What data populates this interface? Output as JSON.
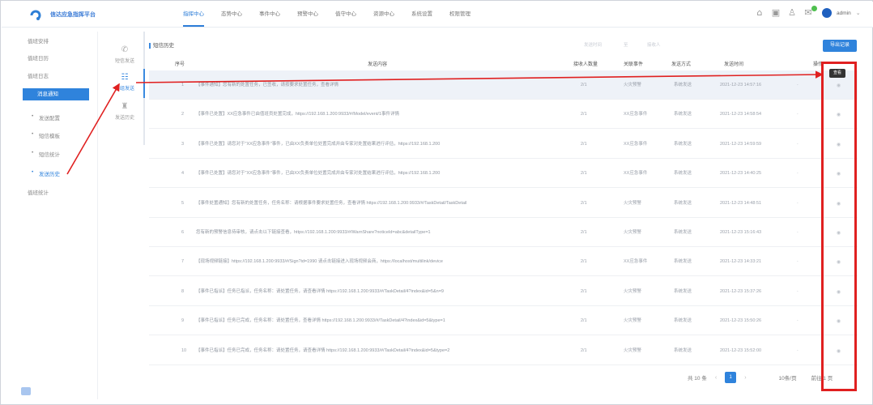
{
  "header": {
    "app_title": "信达应急指挥平台",
    "nav": [
      "指挥中心",
      "态势中心",
      "事件中心",
      "预警中心",
      "值守中心",
      "资源中心",
      "系统设置",
      "权限管理"
    ],
    "user": "admin",
    "icons": [
      "home-icon",
      "screen-icon",
      "user-icon",
      "message-icon"
    ]
  },
  "sidebar": {
    "items": [
      "值班安排",
      "值班日历",
      "值班日志",
      "消息通知",
      "值班统计"
    ],
    "sub": [
      "发送配置",
      "短信模板",
      "短信统计",
      "发送历史"
    ]
  },
  "subtabs": [
    {
      "label": "短信发送",
      "icon": "phone-icon"
    },
    {
      "label": "群组发送",
      "icon": "group-icon"
    },
    {
      "label": "发送历史",
      "icon": "history-icon"
    }
  ],
  "main": {
    "breadcrumb": "短信历史",
    "filters": [
      "发送时间",
      "至",
      "接收人"
    ],
    "export_label": "导出记录",
    "columns": [
      "序号",
      "发送内容",
      "接收人数量",
      "关联事件",
      "发送方式",
      "发送时间",
      "操作"
    ],
    "tooltip": "查看"
  },
  "rows": [
    {
      "n": "1",
      "content": "【事件通知】您有新的处置任务，已签收，请按要求处置任务，查看详情",
      "count": "2/1",
      "event": "火灾预警",
      "way": "系统发送",
      "time": "2021-12-23 14:57:16"
    },
    {
      "n": "2",
      "content": "【事件已处置】XX应急事件已由值班员处置完成，https://192.168.1.200:9933/#/Model/event/1事件详情",
      "count": "2/1",
      "event": "XX应急事件",
      "way": "系统发送",
      "time": "2021-12-23 14:58:54"
    },
    {
      "n": "3",
      "content": "【事件已处置】请您对于\"XX应急事件\"事件，已由XX负责单位处置完成并由专家对处置结果进行评估，https://192.168.1.200",
      "count": "2/1",
      "event": "XX应急事件",
      "way": "系统发送",
      "time": "2021-12-23 14:59:59"
    },
    {
      "n": "4",
      "content": "【事件已处置】请您对于\"XX应急事件\"事件，已由XX负责单位处置完成并由专家对处置结果进行评估，https://192.168.1.200",
      "count": "2/1",
      "event": "XX应急事件",
      "way": "系统发送",
      "time": "2021-12-23 14:40:25"
    },
    {
      "n": "5",
      "content": "【事件处置通知】您有新的处置任务，任务名称：请根据事件要求处置任务，查看详情 https://192.168.1.200:9933/#/TaskDetail/TaskDetail",
      "count": "2/1",
      "event": "火灾预警",
      "way": "系统发送",
      "time": "2021-12-23 14:48:51"
    },
    {
      "n": "6",
      "content": "您有新的预警信息待审核，请点击以下链接查看，https://192.168.1.200:9933/#/WarnShare?noticeId=abc&detailType=1",
      "count": "2/1",
      "event": "火灾预警",
      "way": "系统发送",
      "time": "2021-12-23 15:16:43"
    },
    {
      "n": "7",
      "content": "【现场视频链接】https://192.168.1.200:9933/#/Sign?id=1990 请点击链接进入现场视频会商，https://localhost/multilink/device",
      "count": "2/1",
      "event": "XX应急事件",
      "way": "系统发送",
      "time": "2021-12-23 14:33:21"
    },
    {
      "n": "8",
      "content": "【事件已指派】任务已指派，任务名称：请处置任务，请查看详情 https://192.168.1.200:9933/#/TaskDetail/4?index&id=5&n=9",
      "count": "2/1",
      "event": "火灾预警",
      "way": "系统发送",
      "time": "2021-12-23 15:37:26"
    },
    {
      "n": "9",
      "content": "【事件已指派】任务已完成，任务名称：请处置任务，查看详情 https://192.168.1.200:9933/#/TaskDetail/4?index&id=5&type=1",
      "count": "2/1",
      "event": "火灾预警",
      "way": "系统发送",
      "time": "2021-12-23 15:50:26"
    },
    {
      "n": "10",
      "content": "【事件已指派】任务已完成，任务名称：请处置任务，请查看详情 https://192.168.1.200:9933/#/TaskDetail/4?index&id=5&type=2",
      "count": "2/1",
      "event": "火灾预警",
      "way": "系统发送",
      "time": "2021-12-23 15:52:00"
    }
  ],
  "pager": {
    "total": "共 10 条",
    "current": "1",
    "size": "10条/页",
    "jump": "前往 1 页"
  }
}
